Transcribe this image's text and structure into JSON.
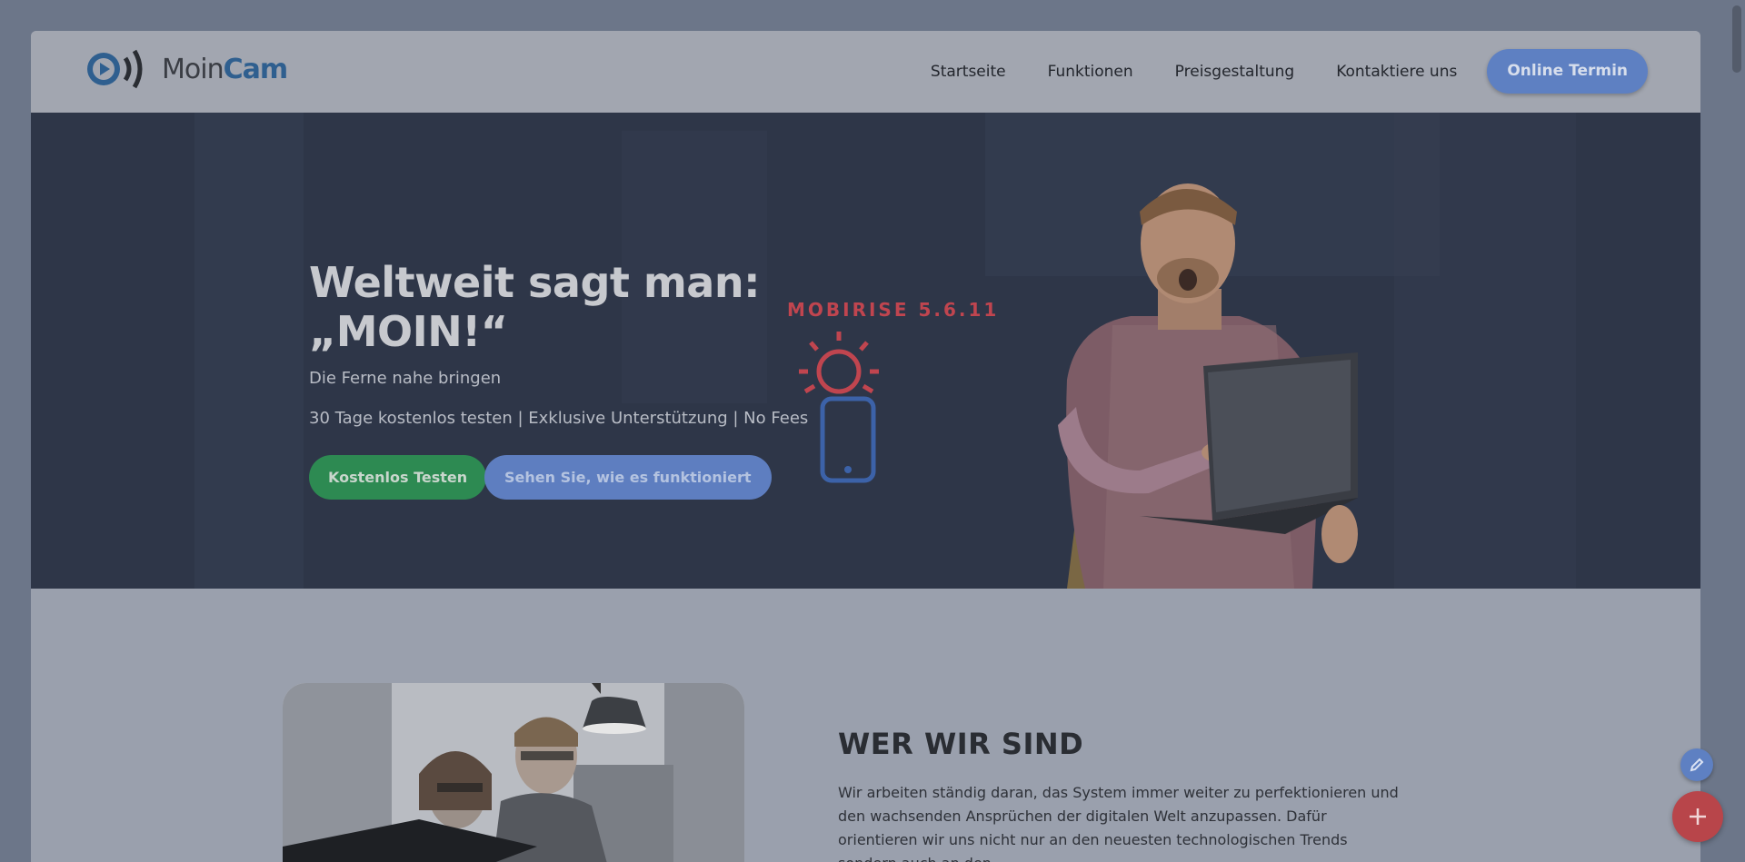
{
  "brand": {
    "name_part1": "Moin",
    "name_part2": "Cam"
  },
  "nav": {
    "items": [
      "Startseite",
      "Funktionen",
      "Preisgestaltung",
      "Kontaktiere uns"
    ],
    "cta": "Online Termin"
  },
  "hero": {
    "title": "Weltweit sagt man: „MOIN!“",
    "subtitle": "Die Ferne nahe bringen",
    "features": "30 Tage kostenlos testen | Exklusive Unterstützung | No Fees",
    "primary_button": "Kostenlos Testen",
    "secondary_button": "Sehen Sie, wie es funktioniert"
  },
  "overlay": {
    "builder_badge": "MOBIRISE  5.6.11"
  },
  "about": {
    "title": "WER WIR SIND",
    "text": "Wir arbeiten ständig daran, das System immer weiter zu perfektionieren und den wachsenden Ansprüchen der digitalen Welt anzupassen. Dafür orientieren wir uns nicht nur an den neuesten technologischen Trends sondern auch an den"
  },
  "colors": {
    "accent_blue": "#5e80c2",
    "accent_green": "#2d8a52",
    "accent_red": "#b8454a",
    "hero_bg": "#2e3648"
  },
  "icons": {
    "logo": "play-wave-icon",
    "edit": "pencil-icon",
    "add": "plus-icon",
    "mobirise": "sun-phone-icon"
  }
}
